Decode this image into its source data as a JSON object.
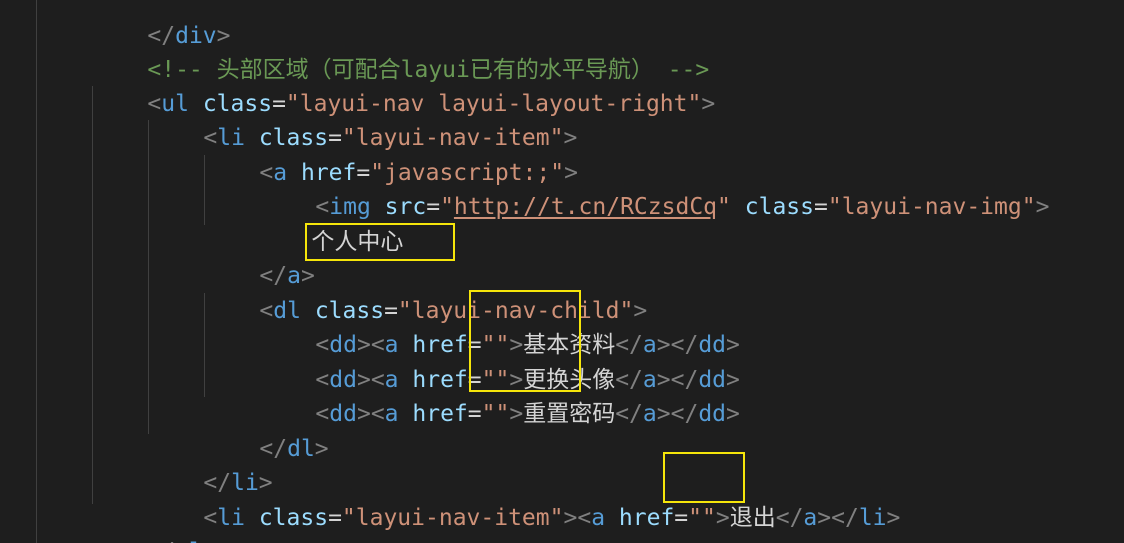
{
  "editor": {
    "lines": {
      "l0": {
        "bracket_open": "</",
        "tag": "div",
        "bracket_close": ">"
      },
      "l1": {
        "comment": "<!-- 头部区域（可配合layui已有的水平导航） -->"
      },
      "l2": {
        "lt": "<",
        "tag": "ul",
        "attr": "class",
        "eq": "=",
        "value": "\"layui-nav layui-layout-right\"",
        "gt": ">"
      },
      "l3": {
        "lt": "<",
        "tag": "li",
        "attr": "class",
        "eq": "=",
        "value": "\"layui-nav-item\"",
        "gt": ">"
      },
      "l4": {
        "lt": "<",
        "tag": "a",
        "attr": "href",
        "eq": "=",
        "value": "\"javascript:;\"",
        "gt": ">"
      },
      "l5": {
        "lt": "<",
        "tag": "img",
        "attr1": "src",
        "eq1": "=",
        "q1": "\"",
        "link": "http://t.cn/RCzsdCq",
        "q2": "\"",
        "attr2": "class",
        "eq2": "=",
        "value2": "\"layui-nav-img\"",
        "gt": ">"
      },
      "l6": {
        "text": "个人中心"
      },
      "l7": {
        "lt": "</",
        "tag": "a",
        "gt": ">"
      },
      "l8": {
        "lt": "<",
        "tag": "dl",
        "attr": "class",
        "eq": "=",
        "value": "\"layui-nav-child\"",
        "gt": ">"
      },
      "l9": {
        "text": "基本资料"
      },
      "l10": {
        "text": "更换头像"
      },
      "l11": {
        "text": "重置密码"
      },
      "l12": {
        "lt": "</",
        "tag": "dl",
        "gt": ">"
      },
      "l13": {
        "lt": "</",
        "tag": "li",
        "gt": ">"
      },
      "l14": {
        "tag1": "li",
        "attr": "class",
        "eq": "=",
        "value": "\"layui-nav-item\"",
        "tag2": "a",
        "attr2": "href",
        "eq2": "=",
        "value2": "\"\"",
        "text": "退出",
        "tag3": "a",
        "tag4": "li"
      },
      "l15": {
        "lt": "</",
        "tag": "ul",
        "gt": ">"
      }
    },
    "dd_row": {
      "lt": "<",
      "dd": "dd",
      "gt": ">",
      "a": "a",
      "href": "href",
      "eq": "=",
      "empty": "\"\"",
      "close_a_lt": "</",
      "close_dd_lt": "</"
    },
    "colors": {
      "background": "#1e1e1e",
      "tag": "#569cd6",
      "attribute": "#9cdcfe",
      "string": "#ce9178",
      "comment": "#6a9955",
      "text": "#d4d4d4",
      "bracket": "#808080",
      "highlight_box": "#f5e50a"
    }
  }
}
